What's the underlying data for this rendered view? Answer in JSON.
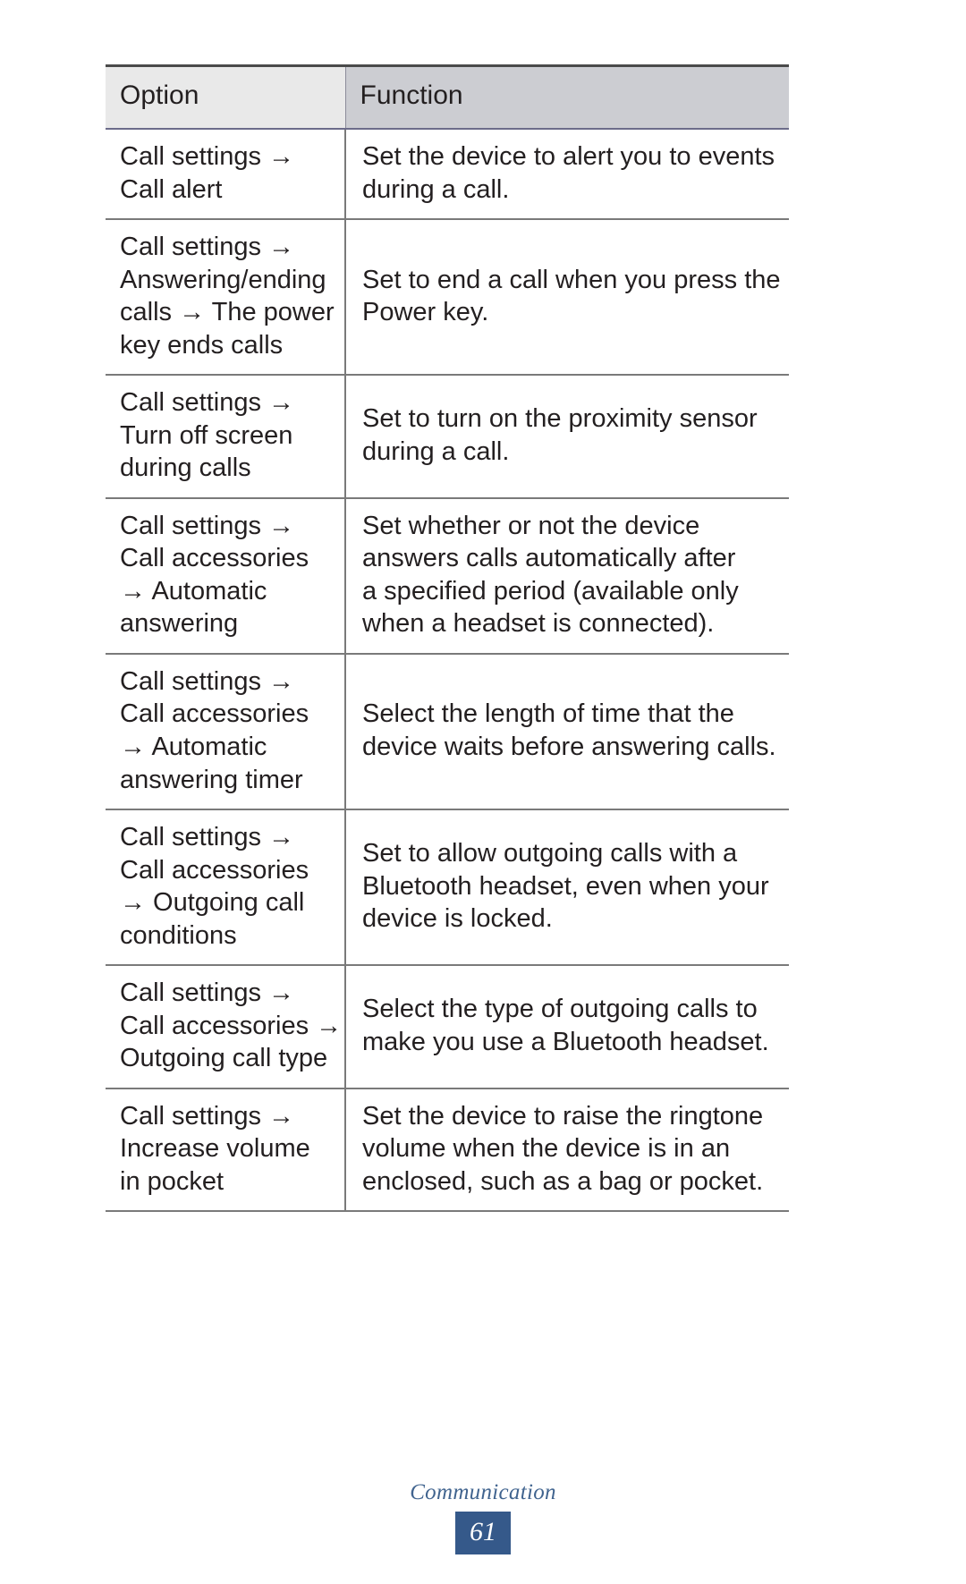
{
  "document": {
    "section_title": "Communication",
    "page_number": "61"
  },
  "table": {
    "headers": {
      "option": "Option",
      "function": "Function"
    },
    "header_colors": {
      "option_bg": "#E9E9E9",
      "function_bg": "#CCCDD2"
    },
    "rows": [
      {
        "option_lines": [
          "Call settings →",
          "Call alert"
        ],
        "function_lines": [
          "Set the device to alert you to events",
          "during a call."
        ]
      },
      {
        "option_lines": [
          "Call settings →",
          "Answering/ending",
          "calls → The power",
          "key ends calls"
        ],
        "function_lines": [
          "Set to end a call when you press the",
          "Power key."
        ]
      },
      {
        "option_lines": [
          "Call settings →",
          "Turn off screen",
          "during calls"
        ],
        "function_lines": [
          "Set to turn on the proximity sensor",
          "during a call."
        ]
      },
      {
        "option_lines": [
          "Call settings →",
          "Call accessories",
          "→ Automatic",
          "answering"
        ],
        "function_lines": [
          "Set whether or not the device",
          "answers calls automatically after",
          "a specified period (available only",
          "when a headset is connected)."
        ]
      },
      {
        "option_lines": [
          "Call settings →",
          "Call accessories",
          "→ Automatic",
          "answering timer"
        ],
        "function_lines": [
          "Select the length of time that the",
          "device waits before answering calls."
        ]
      },
      {
        "option_lines": [
          "Call settings →",
          "Call accessories",
          "→ Outgoing call",
          "conditions"
        ],
        "function_lines": [
          "Set to allow outgoing calls with a",
          "Bluetooth headset, even when your",
          "device is locked."
        ]
      },
      {
        "option_lines": [
          "Call settings →",
          "Call accessories →",
          "Outgoing call type"
        ],
        "function_lines": [
          "Select the type of outgoing calls to",
          "make you use a Bluetooth headset."
        ]
      },
      {
        "option_lines": [
          "Call settings →",
          "Increase volume",
          "in pocket"
        ],
        "function_lines": [
          "Set the device to raise the ringtone",
          "volume when the device is in an",
          "enclosed, such as a bag or pocket."
        ]
      }
    ]
  },
  "footer": {
    "badge_color": "#35598A",
    "title_color": "#41648F"
  }
}
